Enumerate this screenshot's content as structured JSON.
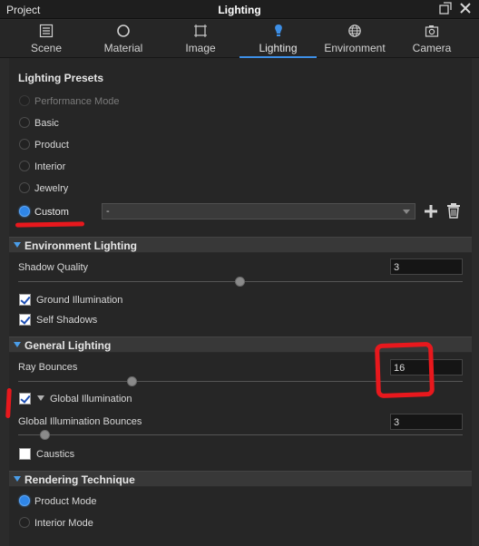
{
  "window": {
    "left_label": "Project",
    "title": "Lighting",
    "buttons": [
      "popout-icon",
      "close-icon"
    ]
  },
  "tabs": [
    {
      "label": "Scene",
      "icon": "scene-icon"
    },
    {
      "label": "Material",
      "icon": "material-icon"
    },
    {
      "label": "Image",
      "icon": "image-icon"
    },
    {
      "label": "Lighting",
      "icon": "lighting-icon",
      "active": true
    },
    {
      "label": "Environment",
      "icon": "environment-icon"
    },
    {
      "label": "Camera",
      "icon": "camera-icon"
    }
  ],
  "presets": {
    "heading": "Lighting Presets",
    "options": [
      {
        "label": "Performance Mode",
        "disabled": true
      },
      {
        "label": "Basic"
      },
      {
        "label": "Product"
      },
      {
        "label": "Interior"
      },
      {
        "label": "Jewelry"
      },
      {
        "label": "Custom",
        "selected": true
      }
    ],
    "custom_dropdown": "-",
    "add_icon": "plus-icon",
    "delete_icon": "trash-icon"
  },
  "environment_lighting": {
    "title": "Environment Lighting",
    "shadow_quality_label": "Shadow Quality",
    "shadow_quality_value": "3",
    "shadow_quality_level": 0.5,
    "ground_illumination": {
      "label": "Ground Illumination",
      "checked": true
    },
    "self_shadows": {
      "label": "Self Shadows",
      "checked": true
    }
  },
  "general_lighting": {
    "title": "General Lighting",
    "ray_bounces_label": "Ray Bounces",
    "ray_bounces_value": "16",
    "ray_bounces_level": 0.26,
    "global_illumination": {
      "label": "Global Illumination",
      "checked": true
    },
    "gi_bounces_label": "Global Illumination Bounces",
    "gi_bounces_value": "3",
    "gi_bounces_level": 0.06,
    "caustics": {
      "label": "Caustics",
      "checked": false
    }
  },
  "rendering_technique": {
    "title": "Rendering Technique",
    "options": [
      {
        "label": "Product Mode",
        "selected": true
      },
      {
        "label": "Interior Mode"
      }
    ]
  },
  "annotation_colors": {
    "red": "#e8181d",
    "accent": "#3d8fe6"
  }
}
